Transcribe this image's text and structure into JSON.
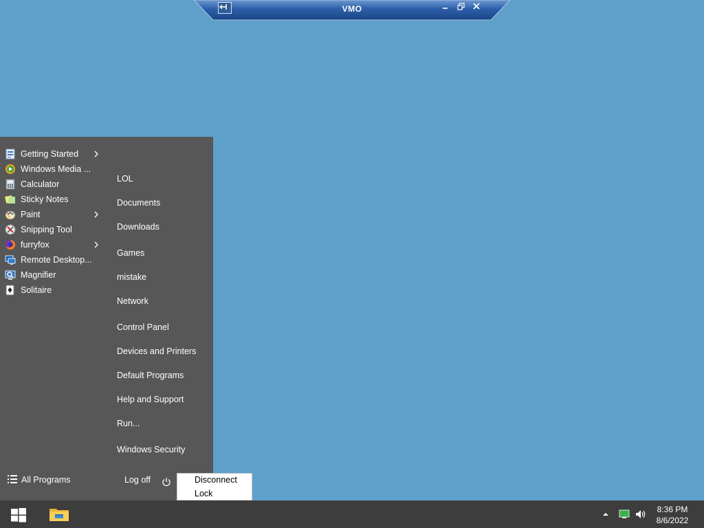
{
  "remote_bar": {
    "title": "VMO"
  },
  "start_menu": {
    "apps": [
      {
        "label": "Getting Started",
        "icon": "getting-started-icon",
        "has_submenu": true
      },
      {
        "label": "Windows Media ...",
        "icon": "windows-media-player-icon",
        "has_submenu": false
      },
      {
        "label": "Calculator",
        "icon": "calculator-icon",
        "has_submenu": false
      },
      {
        "label": "Sticky Notes",
        "icon": "sticky-notes-icon",
        "has_submenu": false
      },
      {
        "label": "Paint",
        "icon": "paint-icon",
        "has_submenu": true
      },
      {
        "label": "Snipping Tool",
        "icon": "snipping-tool-icon",
        "has_submenu": false
      },
      {
        "label": "furryfox",
        "icon": "firefox-icon",
        "has_submenu": true
      },
      {
        "label": "Remote Desktop...",
        "icon": "remote-desktop-icon",
        "has_submenu": false
      },
      {
        "label": "Magnifier",
        "icon": "magnifier-icon",
        "has_submenu": false
      },
      {
        "label": "Solitaire",
        "icon": "solitaire-icon",
        "has_submenu": false
      }
    ],
    "places": [
      "LOL",
      "Documents",
      "Downloads",
      "Games",
      "mistake",
      "Network",
      "Control Panel",
      "Devices and Printers",
      "Default Programs",
      "Help and Support",
      "Run...",
      "Windows Security"
    ],
    "all_programs_label": "All Programs",
    "log_off_label": "Log off"
  },
  "power_menu": {
    "options": [
      "Disconnect",
      "Lock"
    ]
  },
  "taskbar": {
    "time": "8:36 PM",
    "date": "8/6/2022"
  },
  "colors": {
    "desktop": "#5fa0cb",
    "start_menu": "#575757",
    "taskbar": "#3d3d3d"
  }
}
